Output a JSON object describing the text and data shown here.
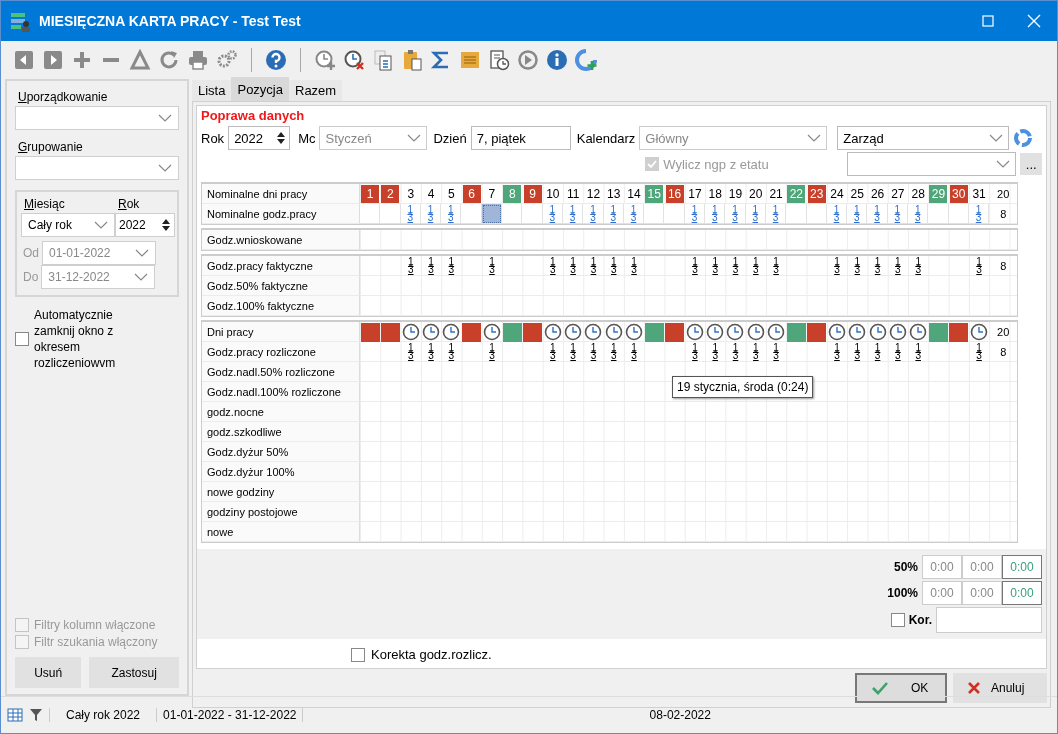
{
  "window": {
    "title": "MIESIĘCZNA KARTA PRACY - Test Test"
  },
  "filters": {
    "ordering": {
      "label": "Uporządkowanie",
      "underline_first": true
    },
    "grouping": {
      "label": "Grupowanie",
      "underline_first": true
    },
    "month_label": "Miesiąc",
    "month": "Cały rok",
    "year_label": "Rok",
    "year": "2022",
    "from_label": "Od",
    "from": "01-01-2022",
    "to_label": "Do",
    "to": "31-12-2022",
    "auto_close": {
      "label": "Automatycznie zamknij okno z okresem rozliczeniowvm",
      "checked": false
    },
    "column_filters": {
      "label": "Filtry kolumn włączone",
      "checked": false,
      "disabled": true
    },
    "search_filter": {
      "label": "Filtr szukania włączony",
      "checked": false,
      "disabled": true
    },
    "buttons": [
      "Usuń",
      "Zastosuj"
    ]
  },
  "tabs": [
    {
      "label": "Lista",
      "selected": false
    },
    {
      "label": "Pozycja",
      "selected": true
    },
    {
      "label": "Razem",
      "selected": false
    }
  ],
  "form": {
    "heading": "Poprawa danych",
    "year_label": "Rok",
    "year": "2022",
    "month_label": "Mc",
    "month": "Styczeń",
    "day_label": "Dzień",
    "day": "7, piątek",
    "calendar_label": "Kalendarz",
    "calendar": "Główny",
    "compute": {
      "label": "Wylicz ngp z etatu",
      "checked": true,
      "disabled": true
    },
    "department": "Zarząd",
    "more": "..."
  },
  "grid": {
    "days": [
      {
        "day": "1",
        "kind": "holiday",
        "selected": false
      },
      {
        "day": "2",
        "kind": "holiday",
        "selected": false
      },
      {
        "day": "3",
        "kind": "work",
        "selected": false,
        "nominal": "13",
        "actual": "13",
        "settled": "13"
      },
      {
        "day": "4",
        "kind": "work",
        "selected": false,
        "nominal": "13",
        "actual": "13",
        "settled": "13"
      },
      {
        "day": "5",
        "kind": "work",
        "selected": false,
        "nominal": "13",
        "actual": "13",
        "settled": "13"
      },
      {
        "day": "6",
        "kind": "holiday",
        "selected": false
      },
      {
        "day": "7",
        "kind": "work",
        "selected": true,
        "actual": "13",
        "settled": "13"
      },
      {
        "day": "8",
        "kind": "free",
        "selected": false
      },
      {
        "day": "9",
        "kind": "holiday",
        "selected": false
      },
      {
        "day": "10",
        "kind": "work",
        "selected": false,
        "nominal": "13",
        "actual": "13",
        "settled": "13"
      },
      {
        "day": "11",
        "kind": "work",
        "selected": false,
        "nominal": "13",
        "actual": "13",
        "settled": "13"
      },
      {
        "day": "12",
        "kind": "work",
        "selected": false,
        "nominal": "13",
        "actual": "13",
        "settled": "13"
      },
      {
        "day": "13",
        "kind": "work",
        "selected": false,
        "nominal": "13",
        "actual": "13",
        "settled": "13"
      },
      {
        "day": "14",
        "kind": "work",
        "selected": false,
        "nominal": "13",
        "actual": "13",
        "settled": "13"
      },
      {
        "day": "15",
        "kind": "free",
        "selected": false
      },
      {
        "day": "16",
        "kind": "holiday",
        "selected": false
      },
      {
        "day": "17",
        "kind": "work",
        "selected": false,
        "nominal": "13",
        "actual": "13",
        "settled": "13"
      },
      {
        "day": "18",
        "kind": "work",
        "selected": false,
        "nominal": "13",
        "actual": "13",
        "settled": "13"
      },
      {
        "day": "19",
        "kind": "work",
        "selected": false,
        "nominal": "13",
        "actual": "13",
        "settled": "13"
      },
      {
        "day": "20",
        "kind": "work",
        "selected": false,
        "nominal": "13",
        "actual": "13",
        "settled": "13"
      },
      {
        "day": "21",
        "kind": "work",
        "selected": false,
        "nominal": "13",
        "actual": "13",
        "settled": "13"
      },
      {
        "day": "22",
        "kind": "free",
        "selected": false
      },
      {
        "day": "23",
        "kind": "holiday",
        "selected": false
      },
      {
        "day": "24",
        "kind": "work",
        "selected": false,
        "nominal": "13",
        "actual": "13",
        "settled": "13"
      },
      {
        "day": "25",
        "kind": "work",
        "selected": false,
        "nominal": "13",
        "actual": "13",
        "settled": "13"
      },
      {
        "day": "26",
        "kind": "work",
        "selected": false,
        "nominal": "13",
        "actual": "13",
        "settled": "13"
      },
      {
        "day": "27",
        "kind": "work",
        "selected": false,
        "nominal": "13",
        "actual": "13",
        "settled": "13"
      },
      {
        "day": "28",
        "kind": "work",
        "selected": false,
        "nominal": "13",
        "actual": "13",
        "settled": "13"
      },
      {
        "day": "29",
        "kind": "free",
        "selected": false
      },
      {
        "day": "30",
        "kind": "holiday",
        "selected": false
      },
      {
        "day": "31",
        "kind": "work",
        "selected": false,
        "nominal": "13",
        "actual": "13",
        "settled": "13"
      }
    ],
    "groups": [
      [
        {
          "label": "Nominalne dni pracy",
          "kind": "days",
          "total": "20"
        },
        {
          "label": "Nominalne godz.pracy",
          "kind": "nominal",
          "color": "#2f6fd0",
          "has_cursor": true,
          "total": "8"
        }
      ],
      [
        {
          "label": "Godz.wnioskowane",
          "kind": "empty"
        }
      ],
      [
        {
          "label": "Godz.pracy faktyczne",
          "kind": "actual",
          "color": "#000000",
          "has_cursor": false,
          "total": "8"
        },
        {
          "label": "Godz.50% faktyczne",
          "kind": "empty"
        },
        {
          "label": "Godz.100% faktyczne",
          "kind": "empty"
        }
      ],
      [
        {
          "label": "Dni pracy",
          "kind": "workdays",
          "total": "20"
        },
        {
          "label": "Godz.pracy rozliczone",
          "kind": "settled",
          "color": "#000000",
          "has_cursor": false,
          "total": "8"
        },
        {
          "label": "Godz.nadl.50% rozliczone",
          "kind": "empty"
        },
        {
          "label": "Godz.nadl.100% rozliczone",
          "kind": "empty"
        },
        {
          "label": "godz.nocne",
          "kind": "empty"
        },
        {
          "label": "godz.szkodliwe",
          "kind": "empty"
        },
        {
          "label": "Godz.dyżur 50%",
          "kind": "empty"
        },
        {
          "label": "Godz.dyżur 100%",
          "kind": "empty"
        },
        {
          "label": "nowe godziny",
          "kind": "empty"
        },
        {
          "label": "godziny postojowe",
          "kind": "empty"
        },
        {
          "label": "nowe",
          "kind": "empty"
        }
      ]
    ],
    "tooltip": "19 stycznia, środa (0:24)"
  },
  "totals": {
    "rows": [
      {
        "label": "50%",
        "values": [
          "0:00",
          "0:00",
          "0:00"
        ]
      },
      {
        "label": "100%",
        "values": [
          "0:00",
          "0:00",
          "0:00"
        ]
      }
    ],
    "correction": {
      "label": "Kor.",
      "checked": false
    }
  },
  "settled_correction": {
    "label": "Korekta godz.rozlicz.",
    "checked": false
  },
  "actions": [
    {
      "label": "OK",
      "kind": "ok"
    },
    {
      "label": "Anuluj",
      "kind": "cancel"
    }
  ],
  "status_bar": {
    "period": "Cały rok 2022",
    "range": "01-01-2022 - 31-12-2022",
    "date": "08-02-2022"
  }
}
